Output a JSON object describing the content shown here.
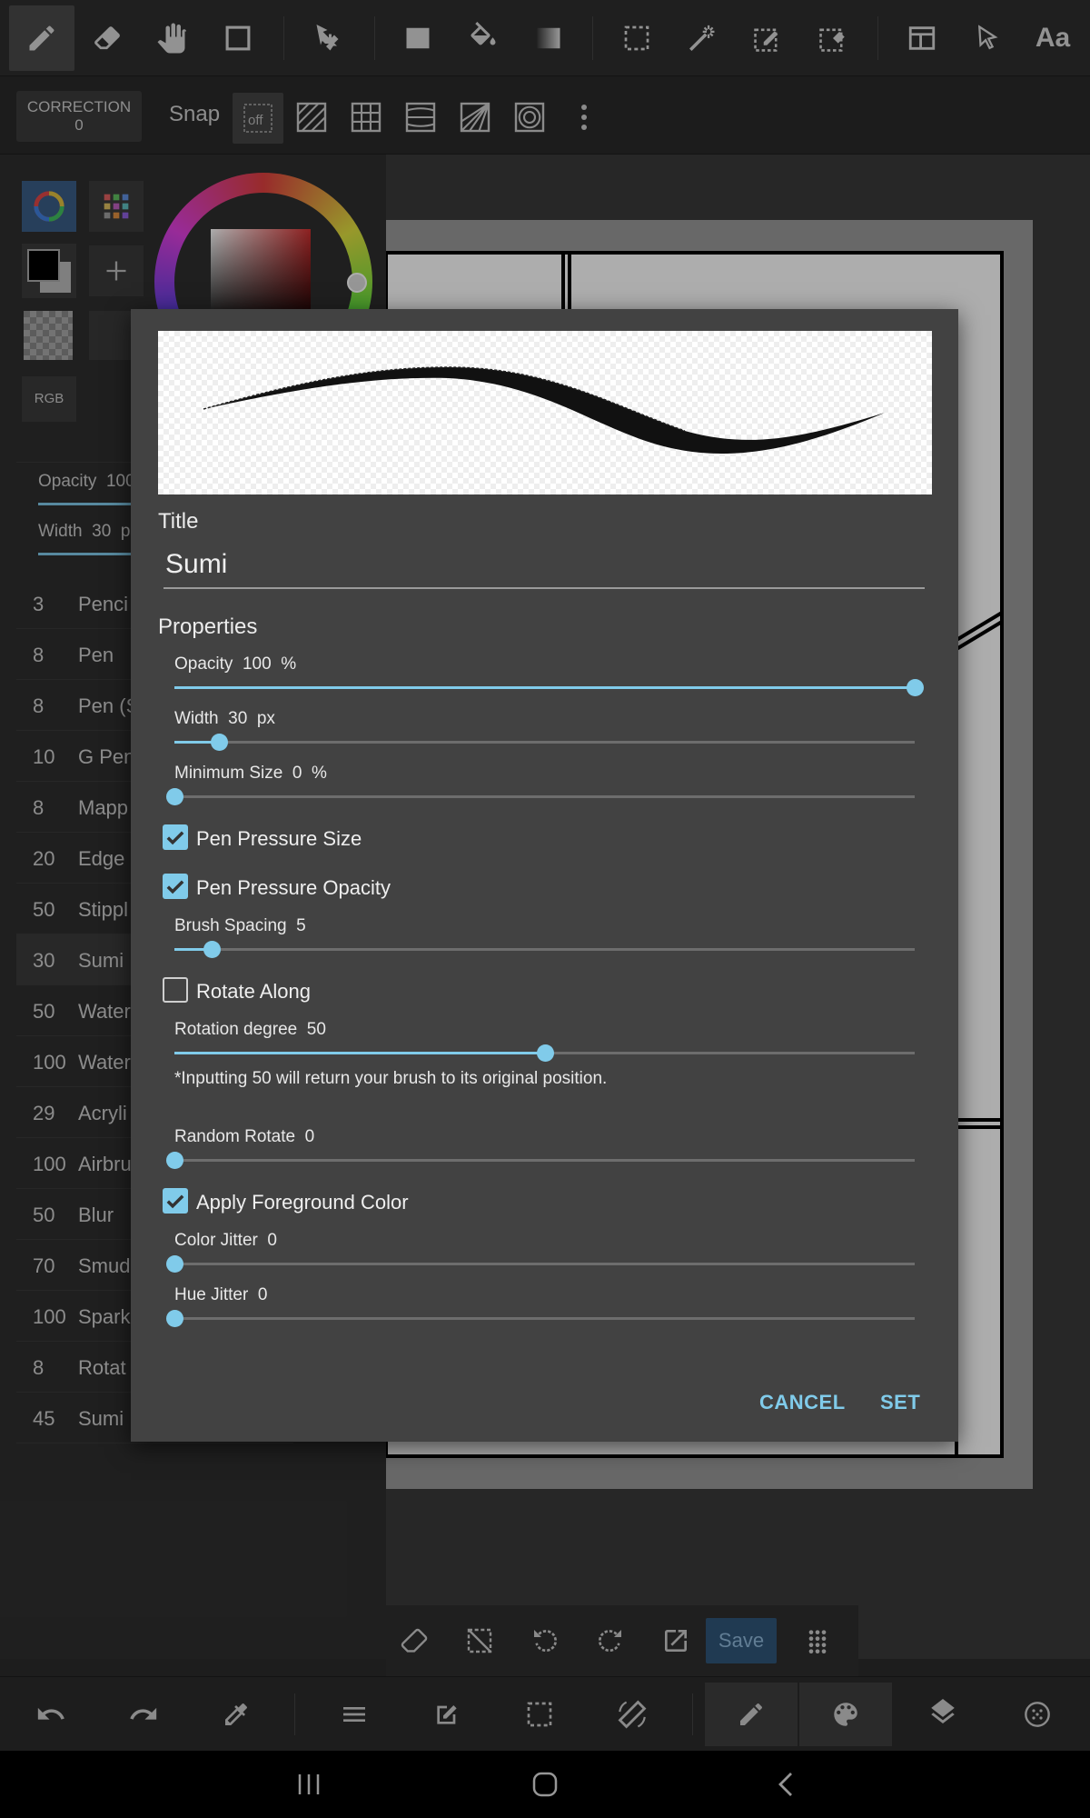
{
  "toolbar": {
    "tools": [
      "pen-icon",
      "eraser-icon",
      "hand-icon",
      "rectangle-icon",
      "move-icon",
      "fill-rect-icon",
      "bucket-icon",
      "gradient-icon",
      "select-rect-icon",
      "magic-wand-icon",
      "select-pen-icon",
      "select-eraser-icon",
      "frame-icon",
      "pointer-icon",
      "text-icon"
    ],
    "text_tool": "Aa"
  },
  "snap_bar": {
    "correction_label": "CORRECTION",
    "correction_value": "0",
    "snap_label": "Snap",
    "snap_off": "off"
  },
  "left_panel": {
    "color_mode": "RGB",
    "opacity_label": "Opacity  100",
    "width_label": "Width  30  p",
    "brushes": [
      {
        "size": "3",
        "name": "Penci"
      },
      {
        "size": "8",
        "name": "Pen"
      },
      {
        "size": "8",
        "name": "Pen (S"
      },
      {
        "size": "10",
        "name": "G Pen"
      },
      {
        "size": "8",
        "name": "Mapp"
      },
      {
        "size": "20",
        "name": "Edge"
      },
      {
        "size": "50",
        "name": "Stippl"
      },
      {
        "size": "30",
        "name": "Sumi"
      },
      {
        "size": "50",
        "name": "Water"
      },
      {
        "size": "100",
        "name": "Water"
      },
      {
        "size": "29",
        "name": "Acryli"
      },
      {
        "size": "100",
        "name": "Airbru"
      },
      {
        "size": "50",
        "name": "Blur"
      },
      {
        "size": "70",
        "name": "Smud"
      },
      {
        "size": "100",
        "name": "Spark"
      },
      {
        "size": "8",
        "name": "Rotat"
      },
      {
        "size": "45",
        "name": "Sumi"
      }
    ],
    "selected_brush_index": 7
  },
  "dialog": {
    "title_label": "Title",
    "title_value": "Sumi",
    "properties_label": "Properties",
    "opacity": {
      "label": "Opacity  100  %",
      "value": 100,
      "max": 100
    },
    "width": {
      "label": "Width  30  px",
      "value": 30,
      "max": 500
    },
    "min_size": {
      "label": "Minimum Size  0  %",
      "value": 0,
      "max": 100
    },
    "pen_pressure_size": {
      "label": "Pen Pressure Size",
      "checked": true
    },
    "pen_pressure_opacity": {
      "label": "Pen Pressure Opacity",
      "checked": true
    },
    "brush_spacing": {
      "label": "Brush Spacing  5",
      "value": 5,
      "max": 100
    },
    "rotate_along": {
      "label": "Rotate Along",
      "checked": false
    },
    "rotation_degree": {
      "label": "Rotation degree  50",
      "value": 50,
      "max": 100
    },
    "rotation_note": "*Inputting 50 will return your brush to its original position.",
    "random_rotate": {
      "label": "Random Rotate  0",
      "value": 0,
      "max": 100
    },
    "apply_fg_color": {
      "label": "Apply Foreground Color",
      "checked": true
    },
    "color_jitter": {
      "label": "Color Jitter  0",
      "value": 0,
      "max": 100
    },
    "hue_jitter": {
      "label": "Hue Jitter  0",
      "value": 0,
      "max": 100
    },
    "cancel_label": "CANCEL",
    "set_label": "SET"
  },
  "canvas_tools": {
    "save_label": "Save"
  },
  "colors": {
    "accent": "#80cbea",
    "dialog_bg": "#424242",
    "app_bg": "#2b2b2b"
  }
}
